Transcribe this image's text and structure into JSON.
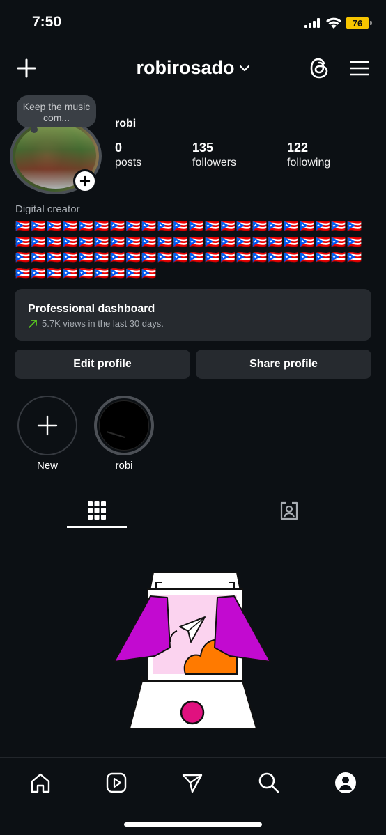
{
  "status_bar": {
    "time": "7:50",
    "battery": "76"
  },
  "header": {
    "username": "robirosado",
    "icons": [
      "plus-icon",
      "chevron-down-icon",
      "threads-icon",
      "hamburger-menu-icon"
    ]
  },
  "profile": {
    "note": "Keep the music com...",
    "display_name": "robi",
    "stats": {
      "posts": {
        "count": "0",
        "label": "posts"
      },
      "followers": {
        "count": "135",
        "label": "followers"
      },
      "following": {
        "count": "122",
        "label": "following"
      }
    },
    "category": "Digital creator",
    "bio": "🇵🇷🇵🇷🇵🇷🇵🇷🇵🇷🇵🇷🇵🇷🇵🇷🇵🇷🇵🇷🇵🇷🇵🇷🇵🇷🇵🇷🇵🇷🇵🇷🇵🇷🇵🇷🇵🇷🇵🇷🇵🇷🇵🇷🇵🇷🇵🇷🇵🇷🇵🇷🇵🇷🇵🇷🇵🇷🇵🇷🇵🇷🇵🇷🇵🇷🇵🇷🇵🇷🇵🇷🇵🇷🇵🇷🇵🇷🇵🇷🇵🇷🇵🇷🇵🇷🇵🇷🇵🇷🇵🇷🇵🇷🇵🇷🇵🇷🇵🇷🇵🇷🇵🇷🇵🇷🇵🇷🇵🇷🇵🇷🇵🇷🇵🇷🇵🇷🇵🇷🇵🇷🇵🇷🇵🇷🇵🇷🇵🇷🇵🇷🇵🇷🇵🇷🇵🇷🇵🇷🇵🇷🇵🇷🇵🇷🇵🇷🇵🇷"
  },
  "dashboard": {
    "title": "Professional dashboard",
    "subtitle": "5.7K views in the last 30 days."
  },
  "buttons": {
    "edit": "Edit profile",
    "share": "Share profile"
  },
  "highlights": [
    {
      "label": "New"
    },
    {
      "label": "robi"
    }
  ],
  "tabs": [
    "grid-icon",
    "tagged-icon"
  ],
  "nav": [
    "home-icon",
    "reels-icon",
    "send-icon",
    "search-icon",
    "profile-icon"
  ],
  "colors": {
    "background": "#0c1014",
    "card": "#262a2f",
    "accent_magenta": "#c20ad0",
    "accent_orange": "#ff7a00",
    "accent_pink": "#e0117f",
    "trend_green": "#58c322"
  }
}
